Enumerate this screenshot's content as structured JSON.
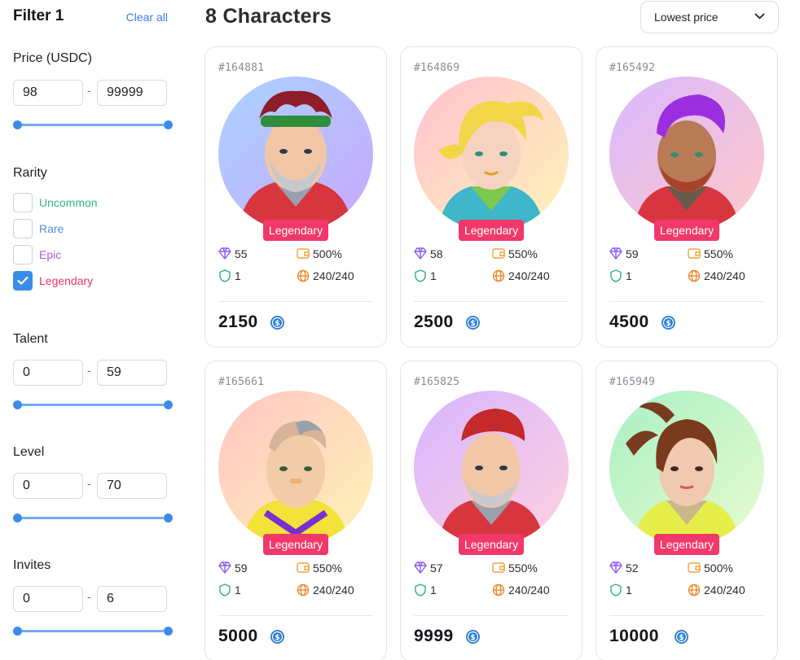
{
  "filters": {
    "title": "Filter 1",
    "clear_label": "Clear all",
    "price": {
      "label": "Price (USDC)",
      "min": "98",
      "max": "99999"
    },
    "rarity": {
      "label": "Rarity",
      "options": [
        {
          "label": "Uncommon",
          "checked": false,
          "color": "#34b389"
        },
        {
          "label": "Rare",
          "checked": false,
          "color": "#4f8de3"
        },
        {
          "label": "Epic",
          "checked": false,
          "color": "#b45ad9"
        },
        {
          "label": "Legendary",
          "checked": true,
          "color": "#e8375e"
        }
      ]
    },
    "talent": {
      "label": "Talent",
      "min": "0",
      "max": "59"
    },
    "level": {
      "label": "Level",
      "min": "0",
      "max": "70"
    },
    "invites": {
      "label": "Invites",
      "min": "0",
      "max": "6"
    },
    "range_separator": "-"
  },
  "main": {
    "title": "8 Characters",
    "sort": {
      "selected": "Lowest price"
    }
  },
  "colors": {
    "accent": "#3b8ce9",
    "legendary": "#f0396a",
    "talent_icon": "#8b5cf6",
    "wallet_icon": "#f2a33a",
    "shield_icon": "#2fb37a",
    "globe_icon": "#f0872b",
    "coin": "#2f7fd6"
  },
  "cards": [
    {
      "id": "#164881",
      "rarity": "Legendary",
      "talent": "55",
      "bonus": "500%",
      "shield": "1",
      "energy": "240/240",
      "price": "2150"
    },
    {
      "id": "#164869",
      "rarity": "Legendary",
      "talent": "58",
      "bonus": "550%",
      "shield": "1",
      "energy": "240/240",
      "price": "2500"
    },
    {
      "id": "#165492",
      "rarity": "Legendary",
      "talent": "59",
      "bonus": "550%",
      "shield": "1",
      "energy": "240/240",
      "price": "4500"
    },
    {
      "id": "#165661",
      "rarity": "Legendary",
      "talent": "59",
      "bonus": "550%",
      "shield": "1",
      "energy": "240/240",
      "price": "5000"
    },
    {
      "id": "#165825",
      "rarity": "Legendary",
      "talent": "57",
      "bonus": "550%",
      "shield": "1",
      "energy": "240/240",
      "price": "9999"
    },
    {
      "id": "#165949",
      "rarity": "Legendary",
      "talent": "52",
      "bonus": "500%",
      "shield": "1",
      "energy": "240/240",
      "price": "10000"
    }
  ]
}
